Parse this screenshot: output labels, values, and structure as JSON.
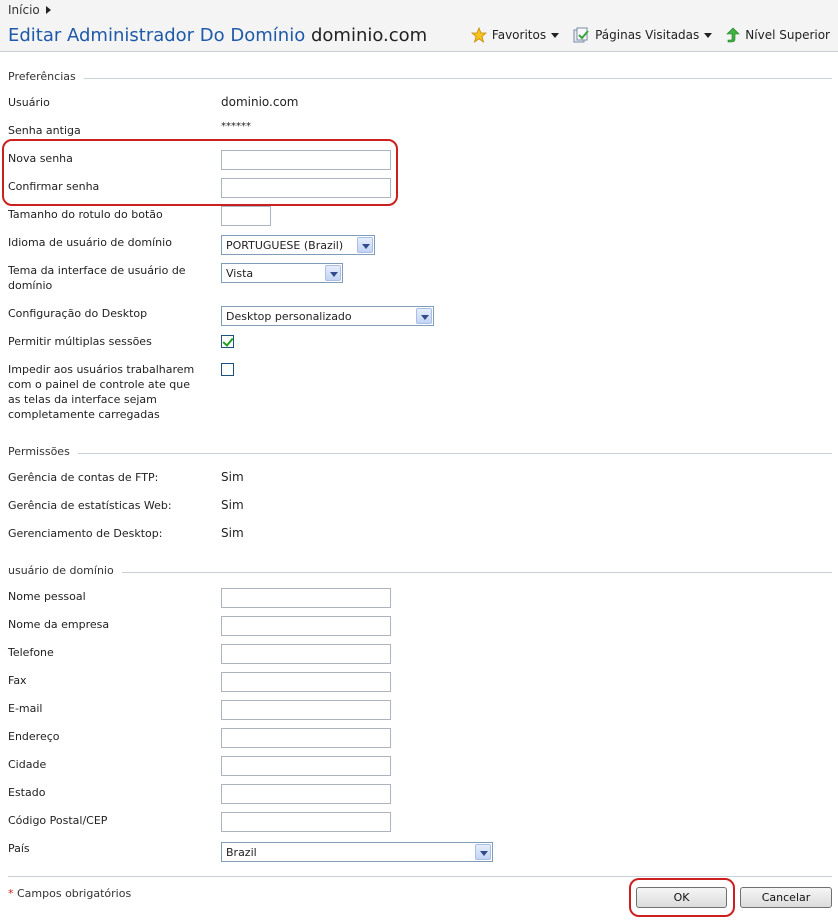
{
  "header": {
    "breadcrumb": "Início",
    "title_main": "Editar Administrador Do Domínio",
    "title_domain": "dominio.com",
    "toolbar": {
      "favorites": "Favoritos",
      "visited": "Páginas Visitadas",
      "up": "Nível Superior"
    }
  },
  "preferences": {
    "legend": "Preferências",
    "username_label": "Usuário",
    "username_value": "dominio.com",
    "old_password_label": "Senha antiga",
    "old_password_value": "******",
    "new_password_label": "Nova senha",
    "confirm_password_label": "Confirmar senha",
    "button_label_size_label": "Tamanho do rotulo do botão",
    "language_label": "Idioma de usuário de domínio",
    "language_value": "PORTUGUESE (Brazil)",
    "theme_label": "Tema da interface de usuário de domínio",
    "theme_value": "Vista",
    "desktop_config_label": "Configuração do Desktop",
    "desktop_config_value": "Desktop personalizado",
    "multi_session_label": "Permitir múltiplas sessões",
    "block_users_label": "Impedir aos usuários trabalharem com o painel de controle ate que as telas da interface sejam completamente carregadas"
  },
  "permissions": {
    "legend": "Permissões",
    "ftp_label": "Gerência de contas de FTP:",
    "ftp_value": "Sim",
    "web_stats_label": "Gerência de estatísticas Web:",
    "web_stats_value": "Sim",
    "desktop_mgmt_label": "Gerenciamento de Desktop:",
    "desktop_mgmt_value": "Sim"
  },
  "domain_user": {
    "legend": "usuário de domínio",
    "personal_name": "Nome pessoal",
    "company": "Nome da empresa",
    "phone": "Telefone",
    "fax": "Fax",
    "email": "E-mail",
    "address": "Endereço",
    "city": "Cidade",
    "state": "Estado",
    "zip": "Código Postal/CEP",
    "country_label": "País",
    "country_value": "Brazil"
  },
  "footer": {
    "required_star": "*",
    "required_text": "Campos obrigatórios",
    "ok": "OK",
    "cancel": "Cancelar"
  },
  "colors": {
    "title_blue": "#1e5aa8",
    "highlight_red": "#cc1f1f"
  }
}
